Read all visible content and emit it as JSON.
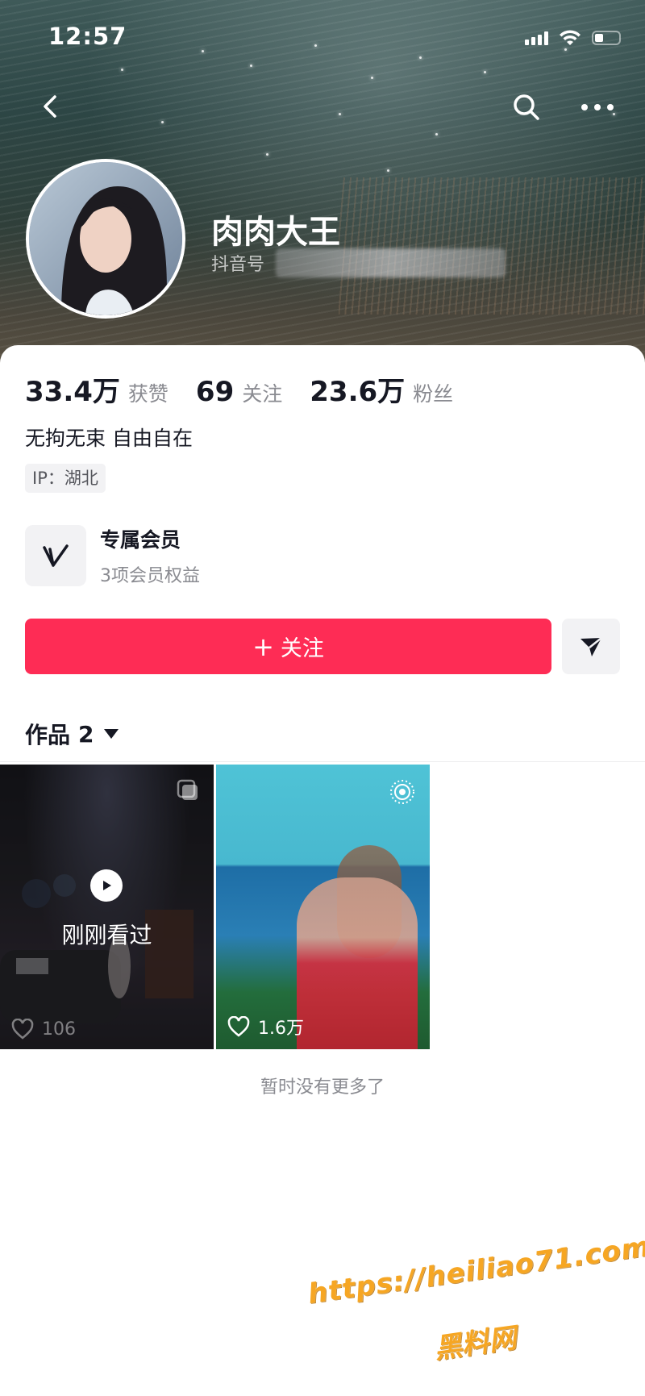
{
  "status_bar": {
    "time": "12:57"
  },
  "profile": {
    "nickname": "肉肉大王",
    "douyin_id_label": "抖音号",
    "stats": [
      {
        "value": "33.4万",
        "label": "获赞"
      },
      {
        "value": "69",
        "label": "关注"
      },
      {
        "value": "23.6万",
        "label": "粉丝"
      }
    ],
    "bio": "无拘无束 自由自在",
    "ip": "IP：湖北"
  },
  "membership": {
    "title": "专属会员",
    "subtitle": "3项会员权益"
  },
  "actions": {
    "follow_plus": "+",
    "follow_label": "关注"
  },
  "works_tab": {
    "label": "作品",
    "count": "2"
  },
  "videos": [
    {
      "likes": "106",
      "overlay": "刚刚看过"
    },
    {
      "likes": "1.6万"
    }
  ],
  "footer": {
    "no_more": "暂时没有更多了"
  },
  "watermark": {
    "url": "https://heiliao71.com",
    "name": "黑料网"
  },
  "colors": {
    "accent": "#fe2c55",
    "text": "#161823",
    "muted": "#8a8b91",
    "chip_bg": "#f2f2f4"
  },
  "icons": [
    "back-icon",
    "search-icon",
    "more-icon",
    "signal-icon",
    "wifi-icon",
    "battery-icon",
    "vip-icon",
    "send-icon",
    "caret-down-icon",
    "play-icon",
    "heart-icon",
    "multi-image-icon",
    "live-photo-icon"
  ]
}
